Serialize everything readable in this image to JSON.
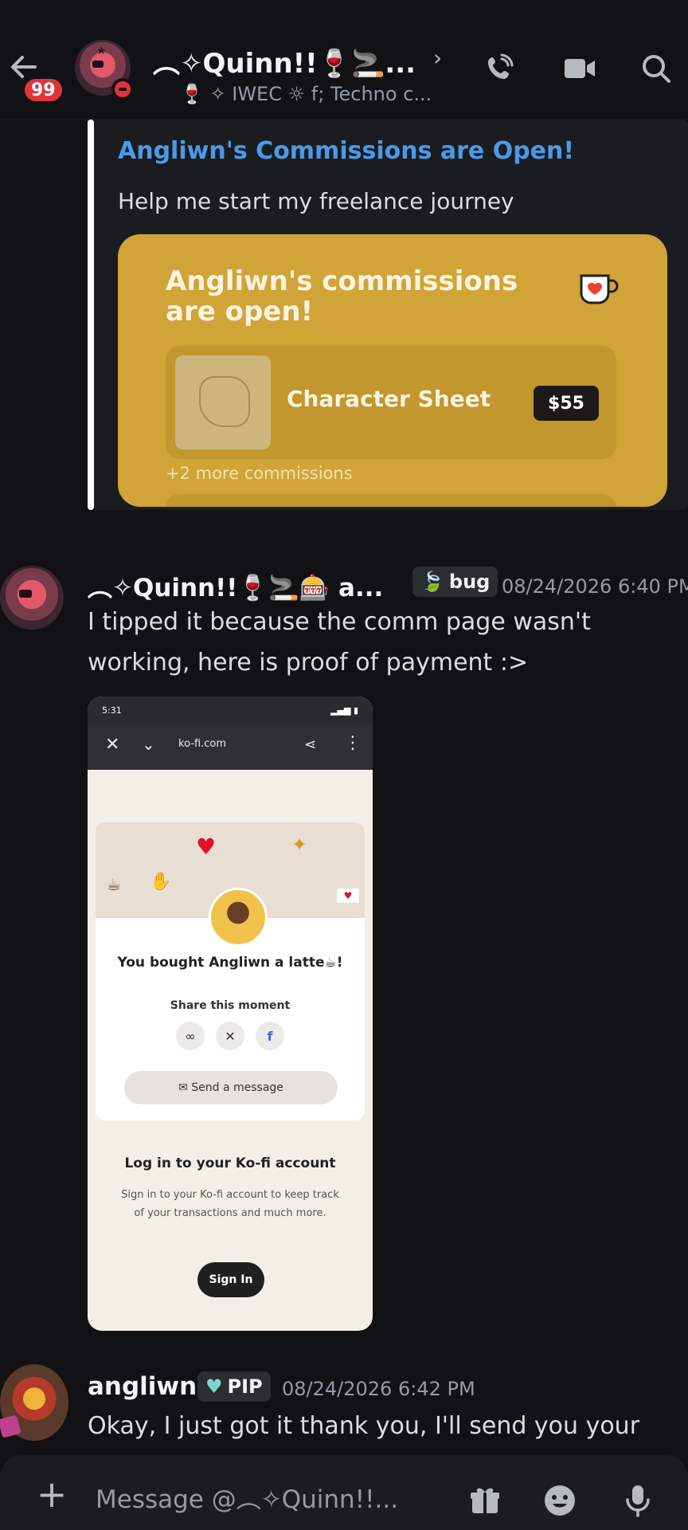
{
  "header": {
    "unread_count": "99",
    "name": "︵✧Quinn!!🍷🚬...",
    "chevron": "›",
    "subtitle": "🍷 ✧ IWEC ☼ f; Techno c..."
  },
  "embed": {
    "title": "Angliwn's Commissions are Open!",
    "description": "Help me start my freelance journey",
    "card": {
      "title": "Angliwn's commissions are open!",
      "item_name": "Character Sheet",
      "item_price": "$55",
      "more": "+2 more commissions"
    }
  },
  "messages": [
    {
      "author": "︵✧Quinn!!🍷🚬🎰 a...",
      "tag": "bug",
      "timestamp": "08/24/2026 6:40 PM",
      "lines": [
        "I tipped it because the comm page wasn't",
        "working, here is proof of payment :>"
      ],
      "attachment": {
        "status_time": "5:31",
        "url": "ko-fi.com",
        "bought": "You bought Angliwn a latte☕!",
        "share_label": "Share this moment",
        "send_message": "Send a message",
        "login_title": "Log in to your Ko-fi account",
        "login_text": "Sign in to your Ko-fi account to keep track of your transactions and much more.",
        "sign_in": "Sign In"
      }
    },
    {
      "author": "angliwn",
      "tag": "PIP",
      "timestamp": "08/24/2026 6:42 PM",
      "lines": [
        "Okay, I just got it thank you, I'll send you your"
      ]
    }
  ],
  "composer": {
    "placeholder": "Message @︵✧Quinn!!..."
  },
  "colors": {
    "background": "#121214",
    "link": "#4a9ae9",
    "kofi_card": "#d1a437",
    "badge": "#e1333b"
  }
}
